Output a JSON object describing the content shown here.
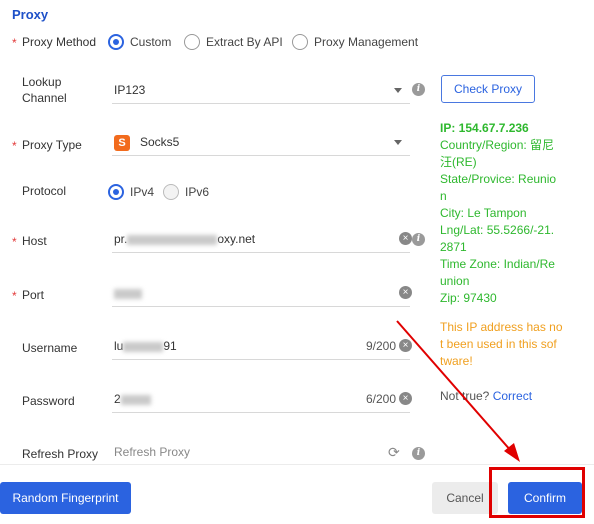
{
  "section_title": "Proxy",
  "labels": {
    "proxy_method": "Proxy Method",
    "lookup_channel": "Lookup\nChannel",
    "proxy_type": "Proxy Type",
    "protocol": "Protocol",
    "host": "Host",
    "port": "Port",
    "username": "Username",
    "password": "Password",
    "refresh_proxy": "Refresh Proxy"
  },
  "proxy_method_options": [
    "Custom",
    "Extract By API",
    "Proxy Management"
  ],
  "protocol_options": [
    "IPv4",
    "IPv6"
  ],
  "fields": {
    "lookup_channel_value": "IP123",
    "proxy_type_value": "Socks5",
    "socks_badge": "S",
    "host_prefix": "pr.",
    "host_suffix": "oxy.net",
    "username_prefix": "lu",
    "username_suffix": "91",
    "username_counter": "9/200",
    "password_prefix": "2",
    "password_counter": "6/200",
    "refresh_placeholder": "Refresh Proxy"
  },
  "buttons": {
    "check_proxy": "Check Proxy",
    "random_fingerprint": "Random Fingerprint",
    "cancel": "Cancel",
    "confirm": "Confirm"
  },
  "ip_info": {
    "ip": "IP:  154.67.7.236",
    "country_line1": "Country/Region: 留尼",
    "country_line2": "汪(RE)",
    "state_line1": "State/Provice: Reunio",
    "state_line2": "n",
    "city": "City: Le Tampon",
    "lnglat_line1": "Lng/Lat: 55.5266/-21.",
    "lnglat_line2": "2871",
    "timezone_line1": "Time Zone: Indian/Re",
    "timezone_line2": "union",
    "zip": "Zip: 97430",
    "unused_line1": "This IP address has no",
    "unused_line2": "t been used in this sof",
    "unused_line3": "tware!",
    "not_true": "Not true?",
    "correct": "Correct"
  },
  "colors": {
    "accent": "#2b63e0",
    "info_green": "#2eb82e",
    "warning_orange": "#f0a020",
    "required_red": "#e23b3b",
    "highlight_red": "#e00000"
  }
}
